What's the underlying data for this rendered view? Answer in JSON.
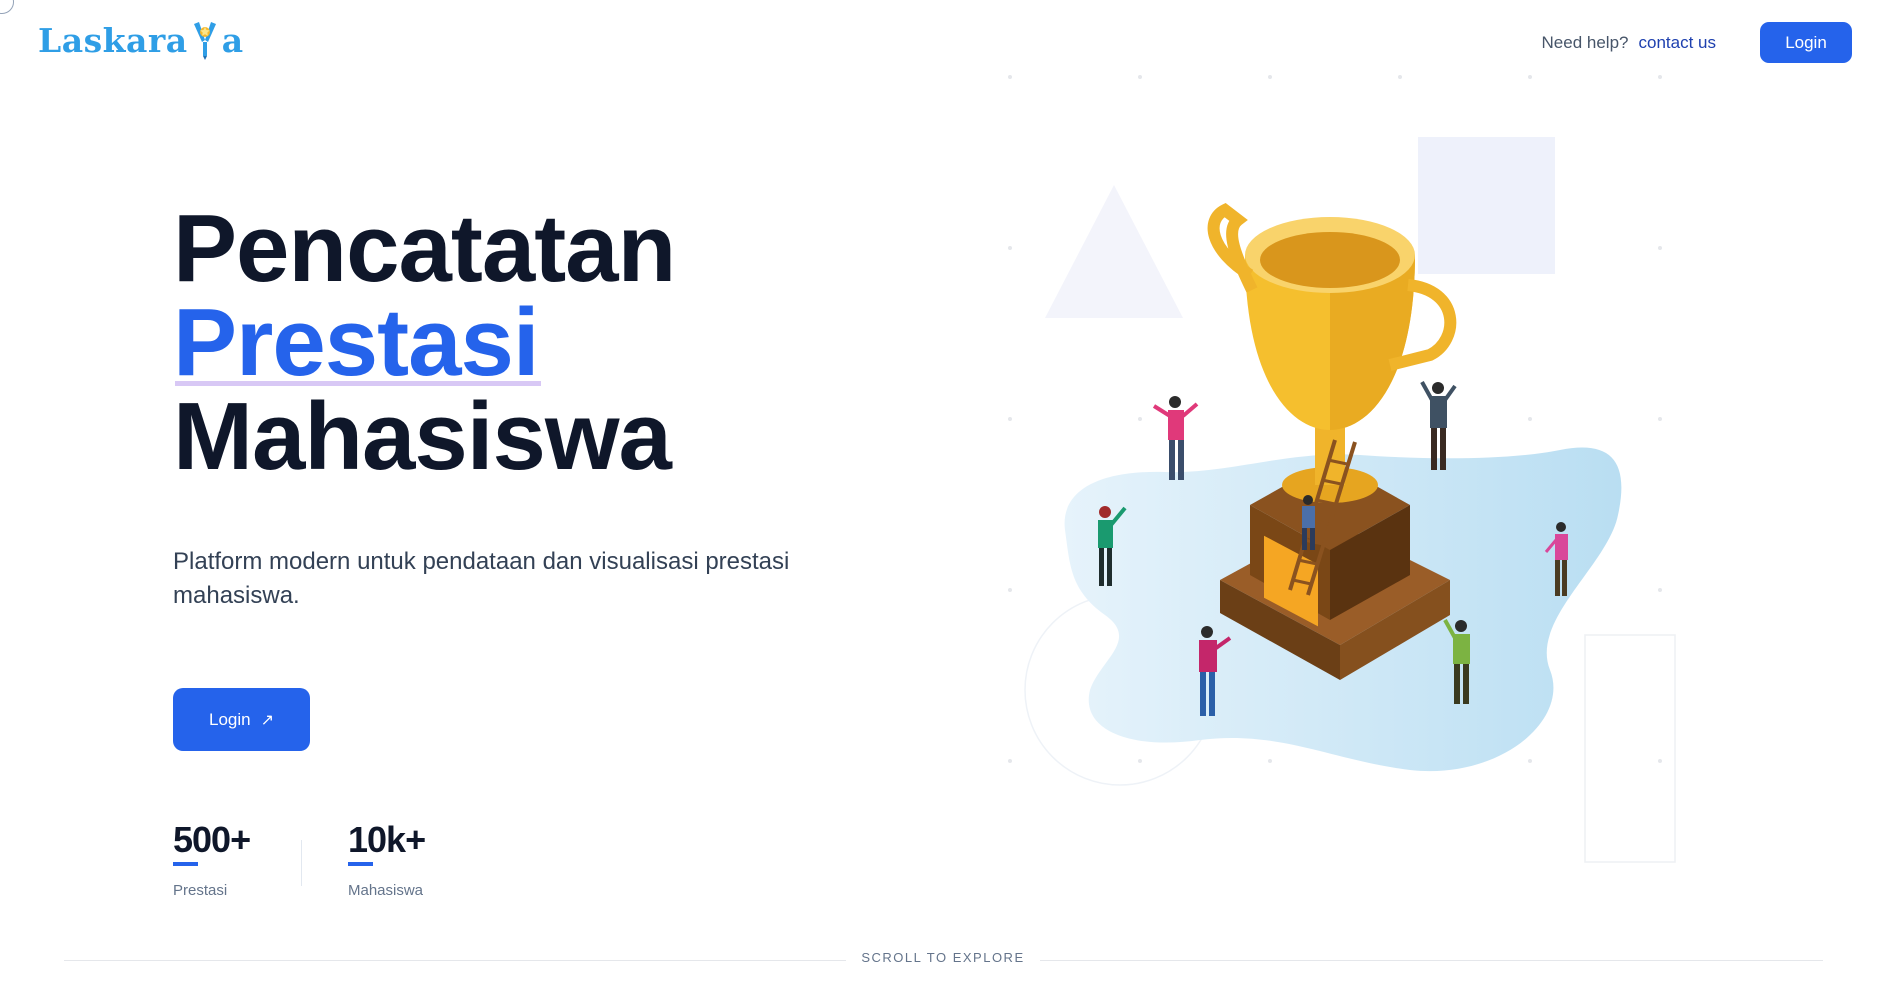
{
  "header": {
    "logo_text_left": "Laskara",
    "logo_text_right": "a",
    "help_text": "Need help?",
    "contact_link": "contact us",
    "login_label": "Login"
  },
  "hero": {
    "title_line1": "Pencatatan",
    "title_line2": "Prestasi",
    "title_line3": "Mahasiswa",
    "description": "Platform modern untuk pendataan dan visualisasi prestasi mahasiswa.",
    "cta_label": "Login",
    "cta_icon": "arrow-up-right-icon"
  },
  "stats": [
    {
      "value": "500+",
      "label": "Prestasi"
    },
    {
      "value": "10k+",
      "label": "Mahasiswa"
    }
  ],
  "scroll_hint": "SCROLL TO EXPLORE",
  "colors": {
    "primary": "#2563eb",
    "dark": "#0f172a",
    "logo": "#2f9ee6",
    "trophy_gold": "#f5b82e",
    "trophy_base": "#7a4a1e",
    "blob": "#cfe8f6"
  }
}
